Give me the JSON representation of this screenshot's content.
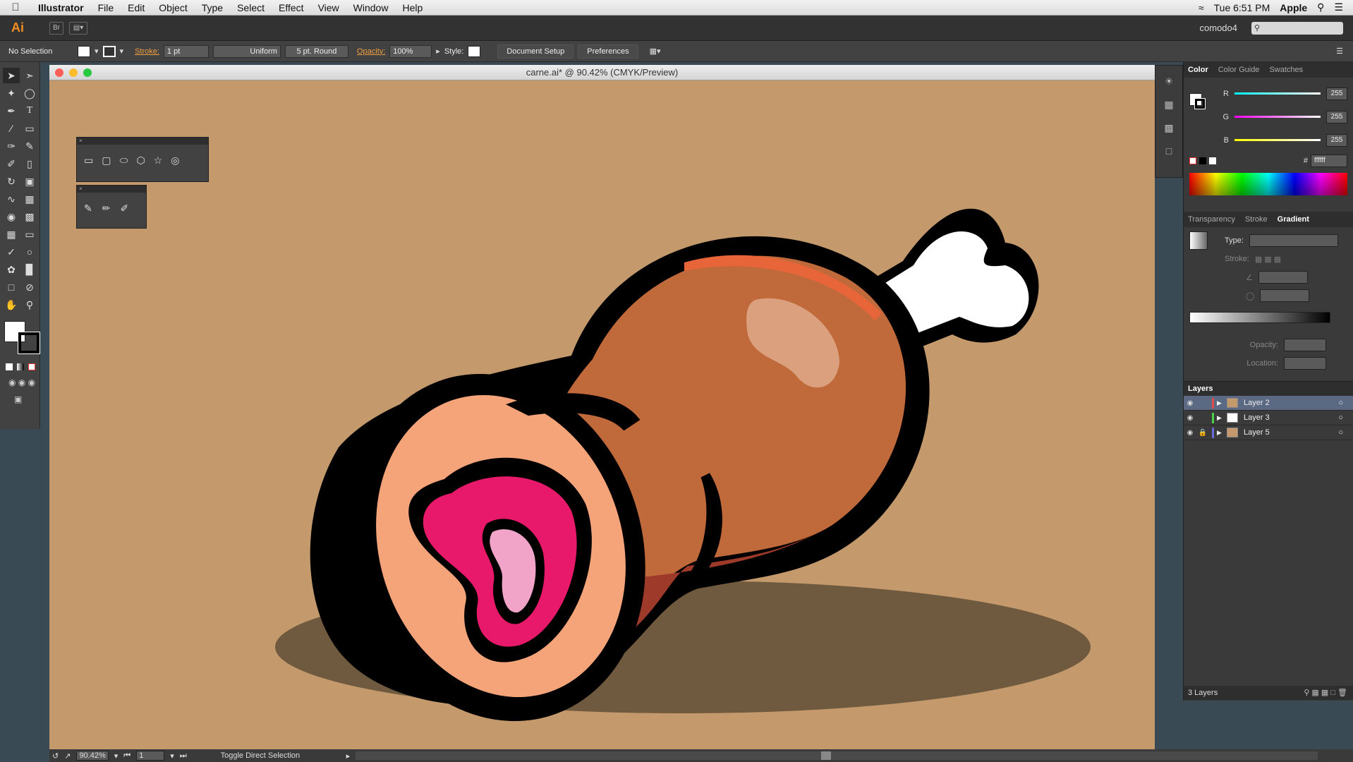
{
  "menubar": {
    "app": "Illustrator",
    "items": [
      "File",
      "Edit",
      "Object",
      "Type",
      "Select",
      "Effect",
      "View",
      "Window",
      "Help"
    ],
    "clock": "Tue 6:51 PM",
    "user": "Apple"
  },
  "appbar": {
    "logo": "Ai",
    "bridge": "Br",
    "workspace": "comodo4"
  },
  "controlbar": {
    "selection": "No Selection",
    "stroke_label": "Stroke:",
    "stroke_value": "1 pt",
    "profile": "Uniform",
    "brush": "5 pt. Round",
    "opacity_label": "Opacity:",
    "opacity_value": "100%",
    "style_label": "Style:",
    "doc_setup": "Document Setup",
    "preferences": "Preferences"
  },
  "document": {
    "title": "carne.ai* @ 90.42% (CMYK/Preview)"
  },
  "status": {
    "zoom": "90.42%",
    "page": "1",
    "message": "Toggle Direct Selection"
  },
  "color_panel": {
    "tabs": [
      "Color",
      "Color Guide",
      "Swatches"
    ],
    "r_label": "R",
    "r": "255",
    "g_label": "G",
    "g": "255",
    "b_label": "B",
    "b": "255",
    "hex_label": "#",
    "hex": "ffffff"
  },
  "gradient_panel": {
    "tabs": [
      "Transparency",
      "Stroke",
      "Gradient"
    ],
    "type_label": "Type:",
    "stroke_label": "Stroke:",
    "opacity_label": "Opacity:",
    "location_label": "Location:"
  },
  "layers_panel": {
    "title": "Layers",
    "layers": [
      {
        "name": "Layer 2",
        "color": "#e04b4b"
      },
      {
        "name": "Layer 3",
        "color": "#4bd04b"
      },
      {
        "name": "Layer 5",
        "color": "#6b6bd8"
      }
    ],
    "count": "3 Layers"
  },
  "colors": {
    "accent": "#f08d24",
    "artboard": "#c49a6c",
    "meat_shell": "#c0693a",
    "meat_inner": "#f5a47a",
    "meat_core": "#e8196a",
    "marrow": "#f2a4c8"
  }
}
